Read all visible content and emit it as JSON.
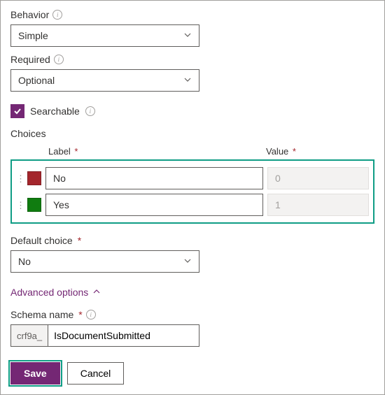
{
  "behavior": {
    "label": "Behavior",
    "value": "Simple"
  },
  "required": {
    "label": "Required",
    "value": "Optional"
  },
  "searchable": {
    "label": "Searchable",
    "checked": true
  },
  "choices": {
    "title": "Choices",
    "label_header": "Label",
    "value_header": "Value",
    "rows": [
      {
        "color": "#a4262c",
        "label": "No",
        "value": "0"
      },
      {
        "color": "#107c10",
        "label": "Yes",
        "value": "1"
      }
    ]
  },
  "default_choice": {
    "label": "Default choice",
    "value": "No"
  },
  "advanced_options": {
    "label": "Advanced options"
  },
  "schema_name": {
    "label": "Schema name",
    "prefix": "crf9a_",
    "value": "IsDocumentSubmitted"
  },
  "buttons": {
    "save": "Save",
    "cancel": "Cancel"
  }
}
